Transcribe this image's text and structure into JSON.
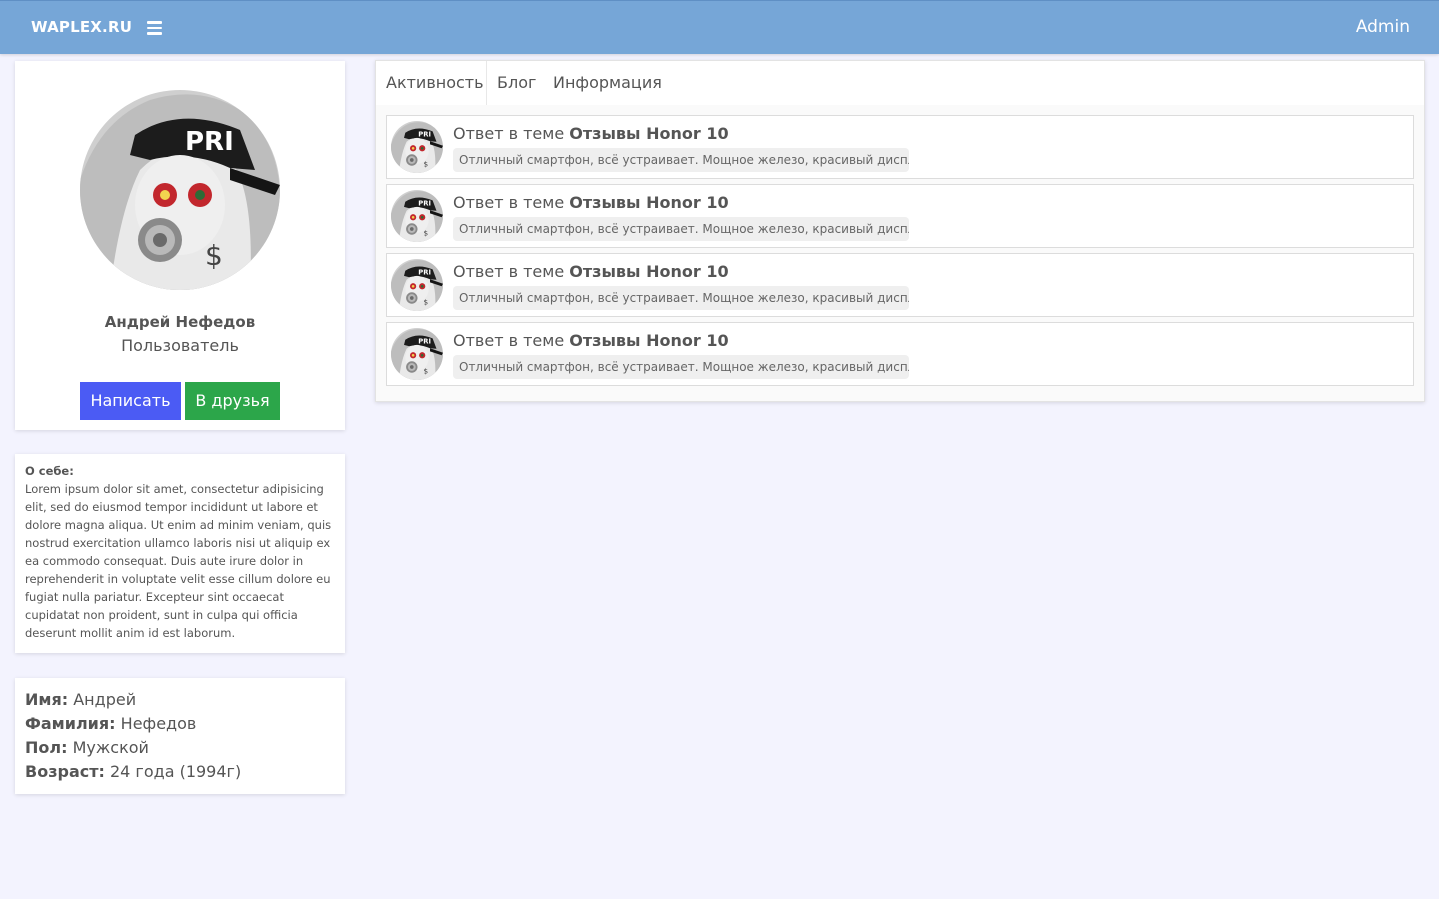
{
  "header": {
    "logo": "WAPLEX.RU",
    "menu_icon": "hamburger-menu-icon",
    "user": "Admin"
  },
  "profile": {
    "avatar_icon": "masked-user-avatar",
    "name": "Андрей Нефедов",
    "role": "Пользователь",
    "write_button": "Написать",
    "friend_button": "В друзья"
  },
  "about": {
    "title": "О себе:",
    "text": "Lorem ipsum dolor sit amet, consectetur adipisicing elit, sed do eiusmod tempor incididunt ut labore et dolore magna aliqua. Ut enim ad minim veniam, quis nostrud exercitation ullamco laboris nisi ut aliquip ex ea commodo consequat. Duis aute irure dolor in reprehenderit in voluptate velit esse cillum dolore eu fugiat nulla pariatur. Excepteur sint occaecat cupidatat non proident, sunt in culpa qui officia deserunt mollit anim id est laborum."
  },
  "info": {
    "rows": [
      {
        "label": "Имя:",
        "value": "Андрей"
      },
      {
        "label": "Фамилия:",
        "value": "Нефедов"
      },
      {
        "label": "Пол:",
        "value": "Мужской"
      },
      {
        "label": "Возраст:",
        "value": "24 года (1994г)"
      }
    ]
  },
  "tabs": [
    "Активность",
    "Блог",
    "Информация"
  ],
  "activity": [
    {
      "prefix": "Ответ в теме",
      "topic": "Отзывы Honor 10",
      "snippet": "Отличный смартфон, всё устраивает. Мощное железо, красивый дисплей..."
    },
    {
      "prefix": "Ответ в теме",
      "topic": "Отзывы Honor 10",
      "snippet": "Отличный смартфон, всё устраивает. Мощное железо, красивый дисплей..."
    },
    {
      "prefix": "Ответ в теме",
      "topic": "Отзывы Honor 10",
      "snippet": "Отличный смартфон, всё устраивает. Мощное железо, красивый дисплей..."
    },
    {
      "prefix": "Ответ в теме",
      "topic": "Отзывы Honor 10",
      "snippet": "Отличный смартфон, всё устраивает. Мощное железо, красивый дисплей..."
    }
  ]
}
